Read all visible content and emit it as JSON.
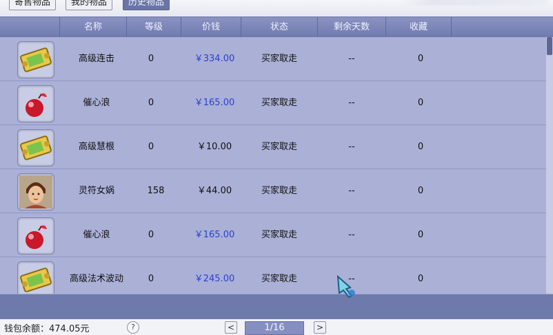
{
  "tabs": [
    {
      "label": "寄售物品",
      "active": false
    },
    {
      "label": "我的物品",
      "active": false
    },
    {
      "label": "历史物品",
      "active": true
    }
  ],
  "columns": [
    "名称",
    "等级",
    "价钱",
    "状态",
    "剩余天数",
    "收藏"
  ],
  "rows": [
    {
      "icon": "scroll-icon",
      "name": "高级连击",
      "level": "0",
      "price": "￥334.00",
      "price_color": "#2a3fd0",
      "status": "买家取走",
      "days": "--",
      "fav": "0"
    },
    {
      "icon": "red-orb-icon",
      "name": "催心浪",
      "level": "0",
      "price": "￥165.00",
      "price_color": "#2a3fd0",
      "status": "买家取走",
      "days": "--",
      "fav": "0"
    },
    {
      "icon": "scroll-icon",
      "name": "高级慧根",
      "level": "0",
      "price": "￥10.00",
      "price_color": "#111111",
      "status": "买家取走",
      "days": "--",
      "fav": "0"
    },
    {
      "icon": "character-portrait-icon",
      "name": "灵符女娲",
      "level": "158",
      "price": "￥44.00",
      "price_color": "#111111",
      "status": "买家取走",
      "days": "--",
      "fav": "0"
    },
    {
      "icon": "red-orb-icon",
      "name": "催心浪",
      "level": "0",
      "price": "￥165.00",
      "price_color": "#2a3fd0",
      "status": "买家取走",
      "days": "--",
      "fav": "0"
    },
    {
      "icon": "scroll-icon",
      "name": "高级法术波动",
      "level": "0",
      "price": "￥245.00",
      "price_color": "#2a3fd0",
      "status": "买家取走",
      "days": "--",
      "fav": "0"
    }
  ],
  "footer": {
    "wallet": "钱包余额：474.05元",
    "help": "?",
    "prev": "<",
    "page": "1/16",
    "next": ">"
  }
}
